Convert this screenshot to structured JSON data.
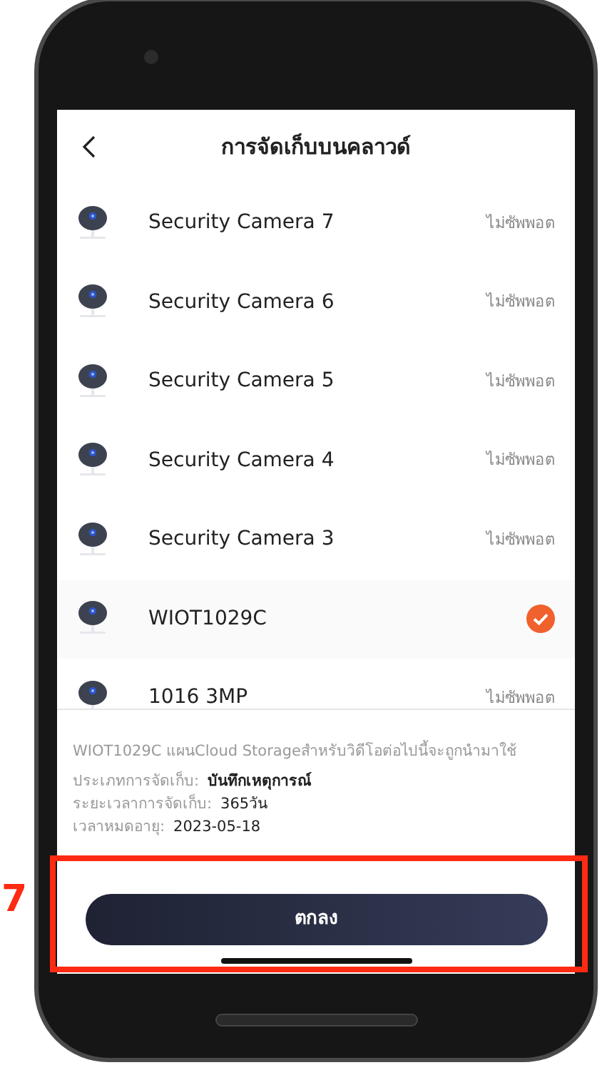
{
  "annotation": {
    "step": "7"
  },
  "header": {
    "title": "การจัดเก็บบนคลาวด์"
  },
  "devices": [
    {
      "name": "Security Camera 7",
      "selected": false,
      "status": "ไม่ซัพพอต"
    },
    {
      "name": "Security Camera 6",
      "selected": false,
      "status": "ไม่ซัพพอต"
    },
    {
      "name": "Security Camera 5",
      "selected": false,
      "status": "ไม่ซัพพอต"
    },
    {
      "name": "Security Camera 4",
      "selected": false,
      "status": "ไม่ซัพพอต"
    },
    {
      "name": "Security Camera 3",
      "selected": false,
      "status": "ไม่ซัพพอต"
    },
    {
      "name": "WIOT1029C",
      "selected": true
    },
    {
      "name": "1016 3MP",
      "selected": false,
      "status": "ไม่ซัพพอต"
    }
  ],
  "info": {
    "description": "WIOT1029C แผนCloud Storageสำหรับวิดีโอต่อไปนี้จะถูกนำมาใช้",
    "fields": [
      {
        "label": "ประเภทการจัดเก็บ:",
        "value": "บันทึกเหตุการณ์",
        "bold": true
      },
      {
        "label": "ระยะเวลาการจัดเก็บ:",
        "value": "365วัน",
        "bold": false
      },
      {
        "label": "เวลาหมดอายุ:",
        "value": "2023-05-18",
        "bold": false
      }
    ]
  },
  "confirm_button": {
    "label": "ตกลง"
  }
}
